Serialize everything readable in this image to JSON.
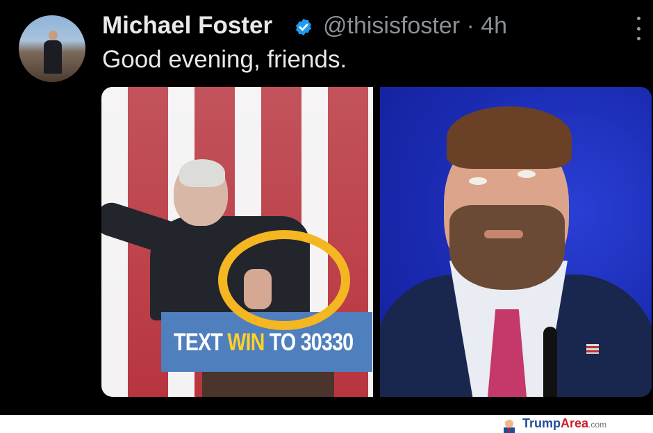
{
  "tweet": {
    "author_name": "Michael Foster",
    "handle": "@thisisfoster",
    "separator": "·",
    "time": "4h",
    "text": "Good evening, friends.",
    "verified": true,
    "icons": {
      "verified": "verified-badge-icon",
      "more": "more-options-icon"
    }
  },
  "media": {
    "left_image": {
      "podium_text_white": "TEXT ",
      "podium_text_highlight": "WIN",
      "podium_text_tail": " TO 30330"
    }
  },
  "watermark": {
    "part1": "Trump",
    "part2": "Area",
    "part3": ".com"
  },
  "colors": {
    "background": "#000000",
    "text": "#e7e9ea",
    "muted": "#8b9196",
    "verified": "#1d9bf0",
    "highlight_ring": "#f4b621"
  }
}
